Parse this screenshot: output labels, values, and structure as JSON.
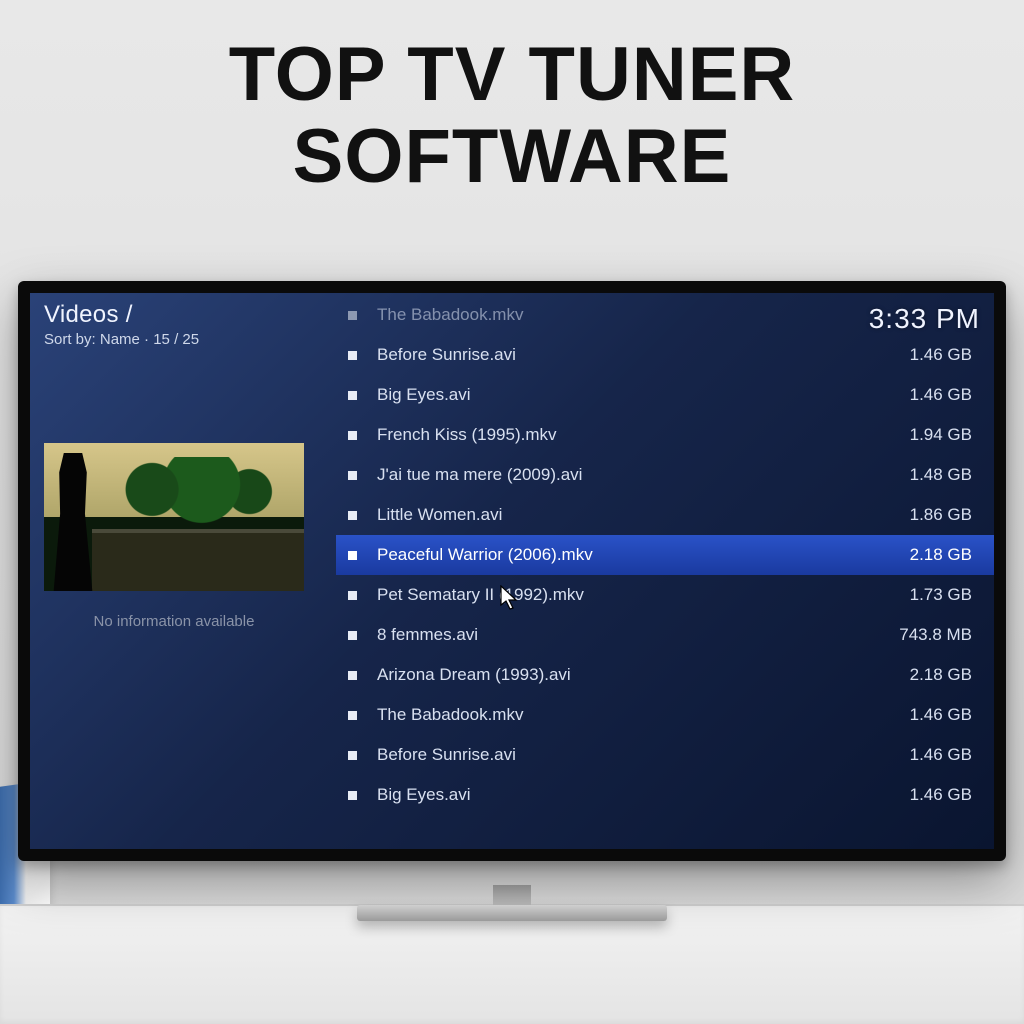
{
  "headline": {
    "line1": "TOP TV TUNER",
    "line2": "SOFTWARE"
  },
  "header": {
    "breadcrumb": "Videos /",
    "sort_prefix": "Sort by:",
    "sort_field": "Name",
    "position": "15 / 25",
    "clock": "3:33 PM"
  },
  "sidebar": {
    "no_info": "No information available"
  },
  "files": [
    {
      "name": "The Babadook.mkv",
      "size": "",
      "dim": true
    },
    {
      "name": "Before Sunrise.avi",
      "size": "1.46 GB",
      "dim": false
    },
    {
      "name": "Big Eyes.avi",
      "size": "1.46 GB",
      "dim": false
    },
    {
      "name": "French Kiss (1995).mkv",
      "size": "1.94 GB",
      "dim": false
    },
    {
      "name": "J'ai tue ma mere (2009).avi",
      "size": "1.48 GB",
      "dim": false
    },
    {
      "name": "Little Women.avi",
      "size": "1.86 GB",
      "dim": false
    },
    {
      "name": "Peaceful Warrior (2006).mkv",
      "size": "2.18 GB",
      "dim": false,
      "selected": true
    },
    {
      "name": "Pet Sematary II (1992).mkv",
      "size": "1.73 GB",
      "dim": false
    },
    {
      "name": "8 femmes.avi",
      "size": "743.8 MB",
      "dim": false
    },
    {
      "name": "Arizona Dream (1993).avi",
      "size": "2.18 GB",
      "dim": false
    },
    {
      "name": "The Babadook.mkv",
      "size": "1.46 GB",
      "dim": false
    },
    {
      "name": "Before Sunrise.avi",
      "size": "1.46 GB",
      "dim": false
    },
    {
      "name": "Big Eyes.avi",
      "size": "1.46 GB",
      "dim": false
    }
  ]
}
